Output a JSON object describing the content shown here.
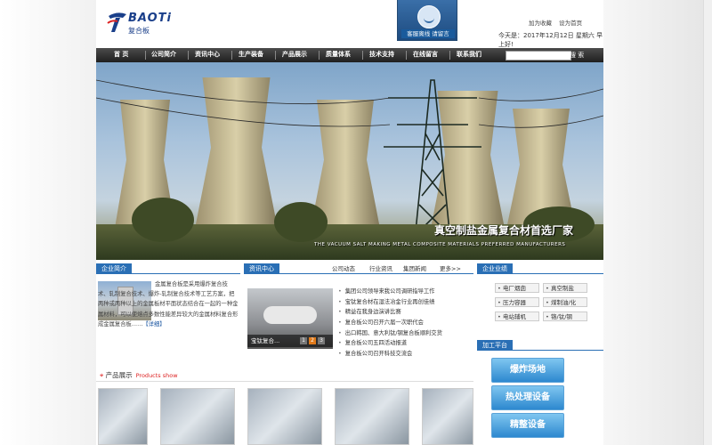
{
  "header": {
    "logo_text": "BAOTi",
    "logo_sub": "复合板",
    "service_label": "客服离线 请留言",
    "links": [
      "加为收藏",
      "设为首页"
    ],
    "date": "今天是：2017年12月12日 星期六 早上好!"
  },
  "nav": {
    "items": [
      "首 页",
      "公司简介",
      "资讯中心",
      "生产装备",
      "产品展示",
      "质量体系",
      "技术支持",
      "在线留言",
      "联系我们"
    ],
    "search_placeholder": "",
    "search_label": "搜 索"
  },
  "banner": {
    "slogan_cn": "真空制盐金属复合材首选厂家",
    "slogan_en": "THE VACUUM SALT MAKING METAL COMPOSITE MATERIALS PREFERRED MANUFACTURERS"
  },
  "intro": {
    "title": "企业简介",
    "text": "金属复合板是采用爆炸复合技术、轧制复合技术、爆炸-轧制复合技术等工艺方案，把两种或两种以上的金属板材平面状态结合在一起的一种金属材料，可以使熔点多数性能差异较大的金属材料复合形成金属复合板……",
    "more": "【详细】"
  },
  "news": {
    "title": "资讯中心",
    "tabs": [
      "公司动态",
      "行业资讯",
      "集团新闻",
      "更多>>"
    ],
    "caption": "宝钛复合...",
    "pages": [
      "1",
      "2",
      "3"
    ],
    "items": [
      "集团公司领导来我公司调研指导工作",
      "宝钛复合材在湿法冶金行业再创佳绩",
      "精益在我身边演讲比赛",
      "复合板公司召开六届一次职代会",
      "出口韩国、意大利钛/钢复合板顺利交货",
      "复合板公司五四活动报道",
      "复合板公司召开科技交流会"
    ]
  },
  "business": {
    "title": "企业业绩",
    "items": [
      "电厂烟囱",
      "真空制盐",
      "压力容器",
      "煤制油/化",
      "电站辅机",
      "铬/钛/钢"
    ]
  },
  "platform": {
    "title": "加工平台",
    "items": [
      "爆炸场地",
      "热处理设备",
      "精整设备"
    ]
  },
  "products": {
    "title": "产品展示",
    "title_en": "Products show"
  }
}
